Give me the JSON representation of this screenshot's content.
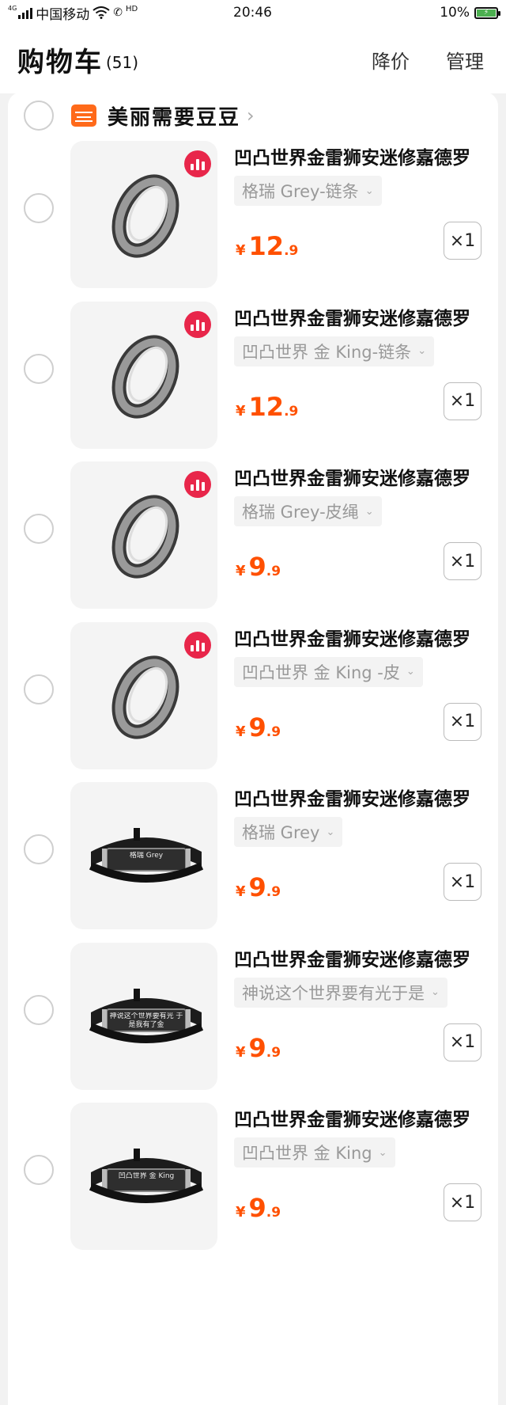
{
  "status_bar": {
    "network": "4G",
    "carrier": "中国移动",
    "hd": "HD",
    "time": "20:46",
    "battery": "10%"
  },
  "header": {
    "title": "购物车",
    "count": "(51)",
    "price_drop_label": "降价",
    "manage_label": "管理"
  },
  "shop": {
    "name": "美丽需要豆豆"
  },
  "items": [
    {
      "title": "凹凸世界金雷狮安迷修嘉德罗",
      "variant": "格瑞 Grey-链条",
      "price_int": "12",
      "price_dec": ".9",
      "currency": "¥",
      "qty": "×1",
      "image": "ring-grey"
    },
    {
      "title": "凹凸世界金雷狮安迷修嘉德罗",
      "variant": "凹凸世界 金 King-链条",
      "price_int": "12",
      "price_dec": ".9",
      "currency": "¥",
      "qty": "×1",
      "image": "ring-king"
    },
    {
      "title": "凹凸世界金雷狮安迷修嘉德罗",
      "variant": "格瑞 Grey-皮绳",
      "price_int": "9",
      "price_dec": ".9",
      "currency": "¥",
      "qty": "×1",
      "image": "ring-grey"
    },
    {
      "title": "凹凸世界金雷狮安迷修嘉德罗",
      "variant": "凹凸世界 金 King -皮",
      "price_int": "9",
      "price_dec": ".9",
      "currency": "¥",
      "qty": "×1",
      "image": "ring-king"
    },
    {
      "title": "凹凸世界金雷狮安迷修嘉德罗",
      "variant": "格瑞 Grey",
      "price_int": "9",
      "price_dec": ".9",
      "currency": "¥",
      "qty": "×1",
      "image": "band-grey",
      "engraving": "格瑞 Grey"
    },
    {
      "title": "凹凸世界金雷狮安迷修嘉德罗",
      "variant": "神说这个世界要有光于是",
      "price_int": "9",
      "price_dec": ".9",
      "currency": "¥",
      "qty": "×1",
      "image": "band-quote",
      "engraving": "神说这个世界要有光 于是我有了金"
    },
    {
      "title": "凹凸世界金雷狮安迷修嘉德罗",
      "variant": "凹凸世界 金 King",
      "price_int": "9",
      "price_dec": ".9",
      "currency": "¥",
      "qty": "×1",
      "image": "band-king",
      "engraving": "凹凸世界 金 King"
    }
  ],
  "colors": {
    "accent": "#ff5000",
    "badge": "#e8264a",
    "shop_icon": "#ff6a1a"
  }
}
